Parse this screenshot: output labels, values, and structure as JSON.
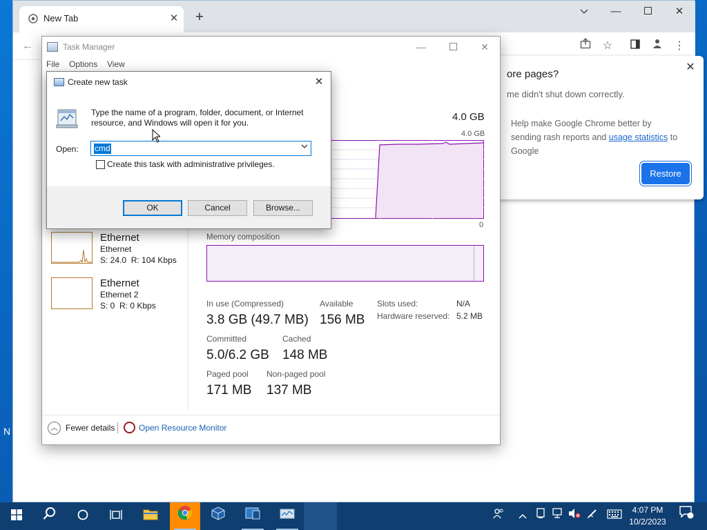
{
  "chrome": {
    "tab_title": "New Tab",
    "tab_favicon": "chrome-logo-icon",
    "restore_bubble": {
      "title": "ore pages?",
      "text": "me didn't shut down correctly.",
      "help_prefix": "Help make Google Chrome better by sending",
      "help_middle": "rash reports and",
      "help_link": "usage statistics",
      "help_suffix": "to Google",
      "restore_button": "Restore"
    }
  },
  "task_manager": {
    "title": "Task Manager",
    "menu": [
      "File",
      "Options",
      "View"
    ],
    "memory_total": "4.0 GB",
    "chart_max": "4.0 GB",
    "chart_min": "0",
    "memory_composition_label": "Memory composition",
    "ethernet": [
      {
        "name": "Ethernet",
        "adapter": "Ethernet",
        "rate": "S: 24.0  R: 104 Kbps"
      },
      {
        "name": "Ethernet",
        "adapter": "Ethernet 2",
        "rate": "S: 0  R: 0 Kbps"
      }
    ],
    "stats": {
      "in_use_label": "In use (Compressed)",
      "in_use_value": "3.8 GB (49.7 MB)",
      "available_label": "Available",
      "available_value": "156 MB",
      "slots_used_label": "Slots used:",
      "slots_used_value": "N/A",
      "hw_reserved_label": "Hardware reserved:",
      "hw_reserved_value": "5.2 MB",
      "committed_label": "Committed",
      "committed_value": "5.0/6.2 GB",
      "cached_label": "Cached",
      "cached_value": "148 MB",
      "paged_label": "Paged pool",
      "paged_value": "171 MB",
      "nonpaged_label": "Non-paged pool",
      "nonpaged_value": "137 MB"
    },
    "fewer_details": "Fewer details",
    "open_resource_monitor": "Open Resource Monitor"
  },
  "run_dialog": {
    "title": "Create new task",
    "description": "Type the name of a program, folder, document, or Internet resource, and Windows will open it for you.",
    "open_label": "Open:",
    "open_value": "cmd",
    "admin_label": "Create this task with administrative privileges.",
    "admin_checked": false,
    "ok": "OK",
    "cancel": "Cancel",
    "browse": "Browse..."
  },
  "desktop": {
    "edge_letter": "N"
  },
  "taskbar": {
    "time": "4:07 PM",
    "date": "10/2/2023",
    "notification_count": "1"
  }
}
